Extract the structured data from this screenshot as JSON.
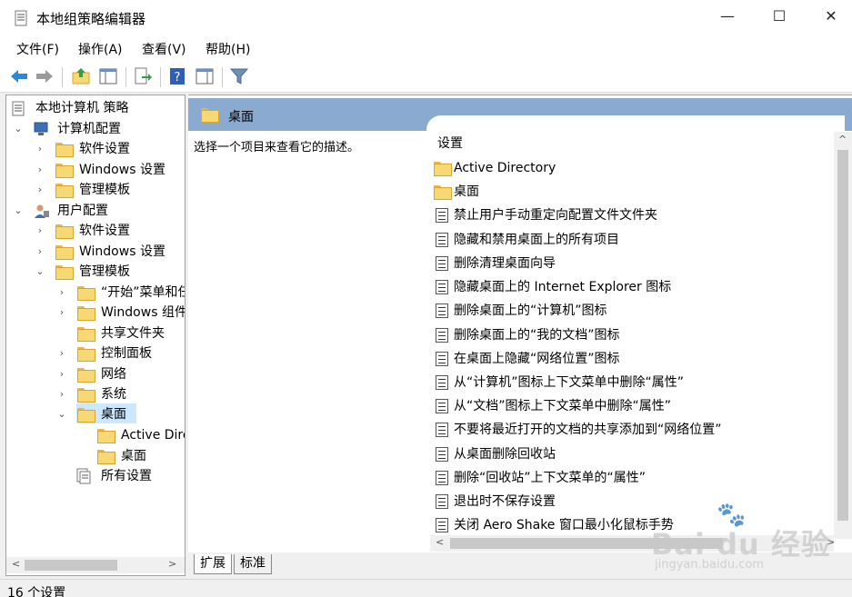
{
  "window": {
    "title": "本地组策略编辑器",
    "controls": {
      "minimize": "—",
      "maximize": "☐",
      "close": "✕"
    }
  },
  "menu": [
    {
      "label": "文件(F)"
    },
    {
      "label": "操作(A)"
    },
    {
      "label": "查看(V)"
    },
    {
      "label": "帮助(H)"
    }
  ],
  "toolbar": {
    "icons": [
      "back-arrow-icon",
      "forward-arrow-icon",
      "up-folder-icon",
      "show-hide-tree-icon",
      "export-list-icon",
      "help-icon",
      "show-action-pane-icon",
      "filter-icon"
    ]
  },
  "tree": {
    "root": "本地计算机 策略",
    "nodes": [
      {
        "label": "计算机配置",
        "expanded": true,
        "icon": "computer-icon"
      },
      {
        "label": "软件设置",
        "expanded": false
      },
      {
        "label": "Windows 设置",
        "expanded": false
      },
      {
        "label": "管理模板",
        "expanded": false
      },
      {
        "label": "用户配置",
        "expanded": true,
        "icon": "user-icon"
      },
      {
        "label": "软件设置",
        "expanded": false
      },
      {
        "label": "Windows 设置",
        "expanded": false
      },
      {
        "label": "管理模板",
        "expanded": true
      },
      {
        "label": "“开始”菜单和任",
        "expanded": false
      },
      {
        "label": "Windows 组件",
        "expanded": false
      },
      {
        "label": "共享文件夹",
        "expanded": null
      },
      {
        "label": "控制面板",
        "expanded": false
      },
      {
        "label": "网络",
        "expanded": false
      },
      {
        "label": "系统",
        "expanded": false
      },
      {
        "label": "桌面",
        "expanded": true,
        "selected": true
      },
      {
        "label": "Active Directory",
        "expanded": null
      },
      {
        "label": "桌面",
        "expanded": null
      },
      {
        "label": "所有设置",
        "expanded": null,
        "icon": "all-settings-icon"
      }
    ]
  },
  "right": {
    "header": "桌面",
    "description": "选择一个项目来查看它的描述。",
    "column": "设置",
    "items": [
      {
        "label": "Active Directory",
        "kind": "folder"
      },
      {
        "label": "桌面",
        "kind": "folder"
      },
      {
        "label": "禁止用户手动重定向配置文件文件夹",
        "kind": "setting"
      },
      {
        "label": "隐藏和禁用桌面上的所有项目",
        "kind": "setting"
      },
      {
        "label": "删除清理桌面向导",
        "kind": "setting"
      },
      {
        "label": "隐藏桌面上的 Internet Explorer 图标",
        "kind": "setting"
      },
      {
        "label": "删除桌面上的“计算机”图标",
        "kind": "setting"
      },
      {
        "label": "删除桌面上的“我的文档”图标",
        "kind": "setting"
      },
      {
        "label": "在桌面上隐藏“网络位置”图标",
        "kind": "setting"
      },
      {
        "label": "从“计算机”图标上下文菜单中删除“属性”",
        "kind": "setting"
      },
      {
        "label": "从“文档”图标上下文菜单中删除“属性”",
        "kind": "setting"
      },
      {
        "label": "不要将最近打开的文档的共享添加到“网络位置”",
        "kind": "setting"
      },
      {
        "label": "从桌面删除回收站",
        "kind": "setting"
      },
      {
        "label": "删除“回收站”上下文菜单的“属性”",
        "kind": "setting"
      },
      {
        "label": "退出时不保存设置",
        "kind": "setting"
      },
      {
        "label": "关闭 Aero Shake 窗口最小化鼠标手势",
        "kind": "setting"
      }
    ]
  },
  "tabs": [
    {
      "label": "扩展"
    },
    {
      "label": "标准"
    }
  ],
  "status": "16 个设置",
  "watermark": {
    "main": "Bai du 经验",
    "sub": "jingyan.baidu.com"
  },
  "colors": {
    "header_bg": "#8aaad0",
    "selection_bg": "#cce8ff",
    "folder": "#f8d775"
  }
}
